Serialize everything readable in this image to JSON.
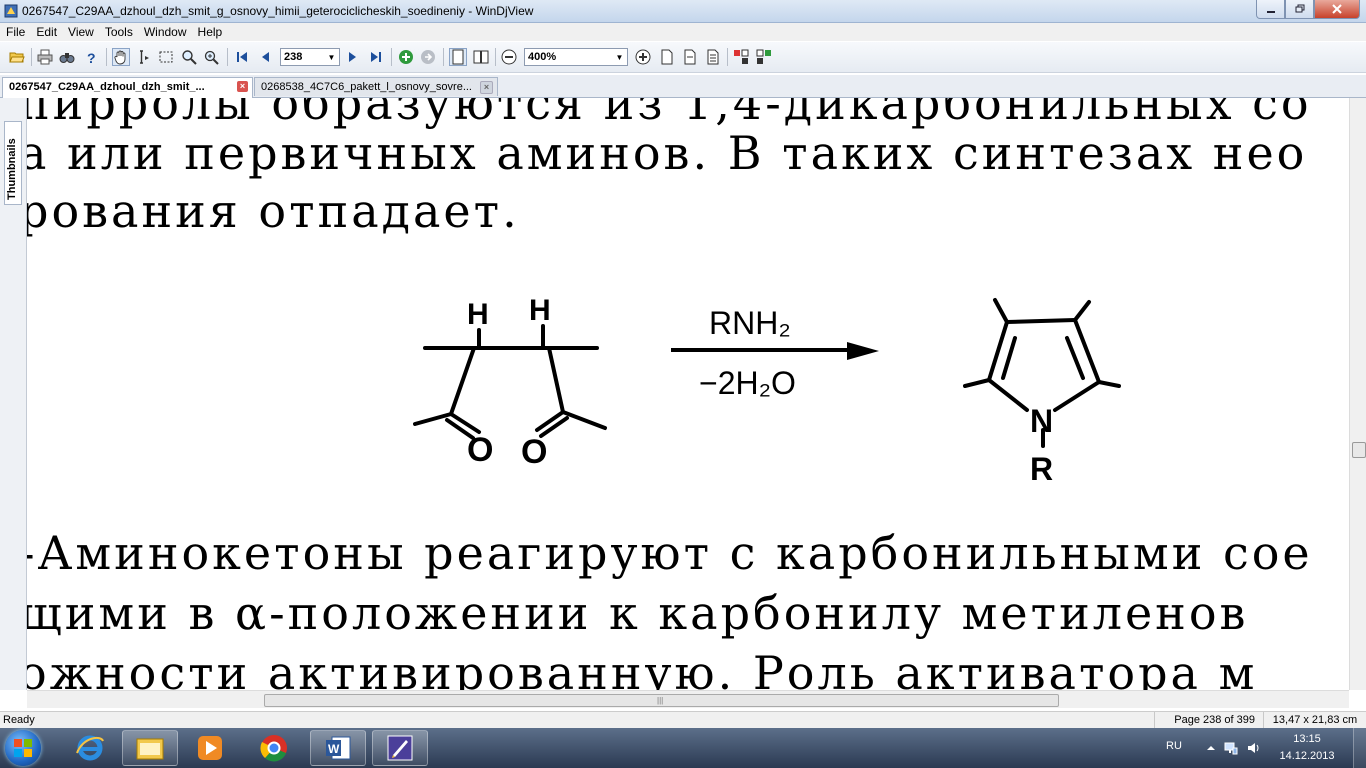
{
  "window": {
    "title": "0267547_C29AA_dzhoul_dzh_smit_g_osnovy_himii_geterociclicheskih_soedineniy - WinDjView"
  },
  "menu": [
    "File",
    "Edit",
    "View",
    "Tools",
    "Window",
    "Help"
  ],
  "toolbar": {
    "page_number": "238",
    "zoom": "400%"
  },
  "tabs": [
    {
      "label": "0267547_C29AA_dzhoul_dzh_smit_..."
    },
    {
      "label": "0268538_4C7C6_pakett_l_osnovy_sovre..."
    }
  ],
  "sidebar": {
    "thumbnails_label": "Thumbnails"
  },
  "document": {
    "lines_top": [
      "пирролы образуются из 1,4-дикарбонильных со",
      "а или первичных аминов. В таких синтезах нео",
      "рования отпадает."
    ],
    "scheme": {
      "atom_h1": "H",
      "atom_h2": "H",
      "oxygen1": "O",
      "oxygen2": "O",
      "reagent": "RNH₂",
      "byproduct": "−2H₂O",
      "ring_n": "N",
      "ring_r": "R"
    },
    "lines_bottom": [
      "-Аминокетоны реагируют с карбонильными  сое",
      "щими в α-положении к карбонилу метиленов",
      "ожности активированную. Роль активатора  м"
    ]
  },
  "statusbar": {
    "ready": "Ready",
    "page_info": "Page 238 of 399",
    "page_size": "13,47 x 21,83 cm"
  },
  "taskbar": {
    "lang": "RU",
    "time": "13:15",
    "date": "14.12.2013"
  }
}
